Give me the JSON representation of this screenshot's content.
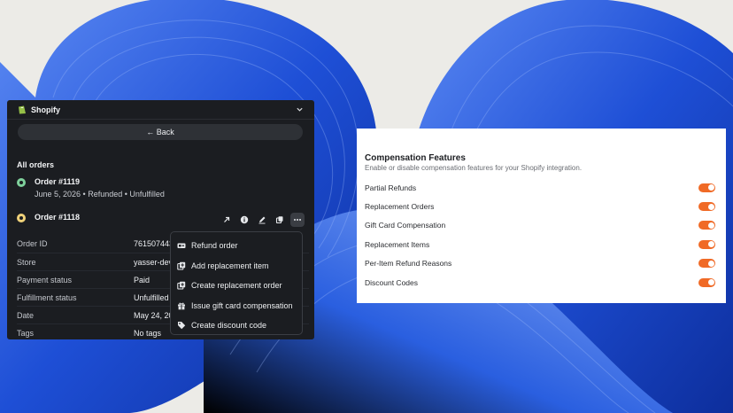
{
  "shopify_panel": {
    "title": "Shopify",
    "back_label": "← Back",
    "section_title": "All orders",
    "orders": [
      {
        "number": "Order #1119",
        "meta": "June 5, 2026 • Refunded • Unfulfilled"
      },
      {
        "number": "Order #1118"
      }
    ],
    "details": [
      {
        "label": "Order ID",
        "value": "761507443"
      },
      {
        "label": "Store",
        "value": "yasser-dev"
      },
      {
        "label": "Payment status",
        "value": "Paid"
      },
      {
        "label": "Fulfillment status",
        "value": "Unfulfilled"
      },
      {
        "label": "Date",
        "value": "May 24, 20"
      },
      {
        "label": "Tags",
        "value": "No tags"
      }
    ],
    "action_icons": [
      "external-link-icon",
      "info-icon",
      "edit-icon",
      "copy-icon",
      "more-icon"
    ],
    "menu": [
      {
        "label": "Refund order",
        "icon": "refund-icon"
      },
      {
        "label": "Add replacement item",
        "icon": "replacement-item-icon"
      },
      {
        "label": "Create replacement order",
        "icon": "replacement-order-icon"
      },
      {
        "label": "Issue gift card compensation",
        "icon": "gift-icon"
      },
      {
        "label": "Create discount code",
        "icon": "tag-icon"
      }
    ]
  },
  "compensation": {
    "title": "Compensation Features",
    "subtitle": "Enable or disable compensation features for your Shopify integration.",
    "features": [
      {
        "label": "Partial Refunds",
        "enabled": true
      },
      {
        "label": "Replacement Orders",
        "enabled": true
      },
      {
        "label": "Gift Card Compensation",
        "enabled": true
      },
      {
        "label": "Replacement Items",
        "enabled": true
      },
      {
        "label": "Per-Item Refund Reasons",
        "enabled": true
      },
      {
        "label": "Discount Codes",
        "enabled": true
      }
    ]
  },
  "colors": {
    "toggle_on": "#f06a26",
    "panel_bg": "#1b1d21",
    "background_blue": "#2a5fe0",
    "order_green": "#7fd19c",
    "order_yellow": "#f0d27a"
  }
}
